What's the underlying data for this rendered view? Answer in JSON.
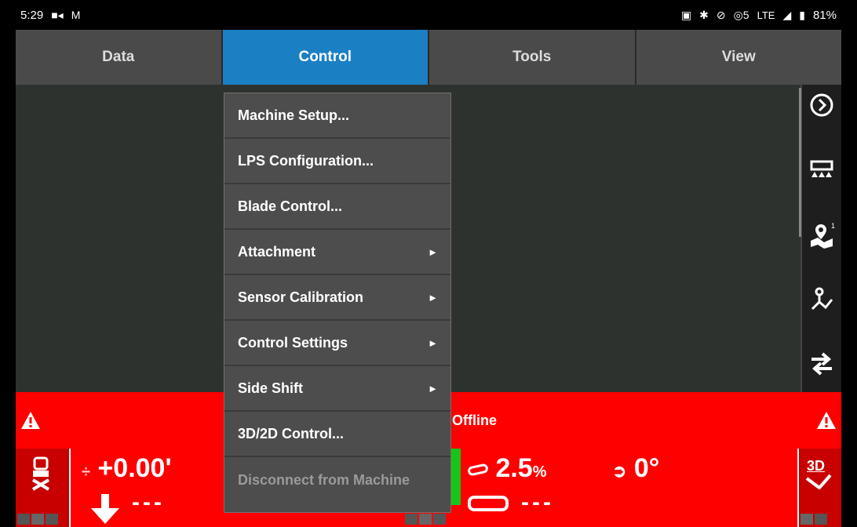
{
  "statusbar": {
    "time": "5:29",
    "left_icons": [
      "video-icon",
      "gmail-icon"
    ],
    "right_text": "LTE",
    "battery": "81%",
    "sim_label": "5"
  },
  "tabs": [
    {
      "label": "Data",
      "active": false
    },
    {
      "label": "Control",
      "active": true
    },
    {
      "label": "Tools",
      "active": false
    },
    {
      "label": "View",
      "active": false
    }
  ],
  "menu": {
    "items": [
      {
        "label": "Machine Setup...",
        "submenu": false,
        "disabled": false
      },
      {
        "label": "LPS Configuration...",
        "submenu": false,
        "disabled": false
      },
      {
        "label": "Blade Control...",
        "submenu": false,
        "disabled": false
      },
      {
        "label": "Attachment",
        "submenu": true,
        "disabled": false
      },
      {
        "label": "Sensor Calibration",
        "submenu": true,
        "disabled": false
      },
      {
        "label": "Control Settings",
        "submenu": true,
        "disabled": false
      },
      {
        "label": "Side Shift",
        "submenu": true,
        "disabled": false
      },
      {
        "label": "3D/2D Control...",
        "submenu": false,
        "disabled": false
      },
      {
        "label": "Disconnect from Machine",
        "submenu": false,
        "disabled": true
      }
    ],
    "submenu_arrow": "►"
  },
  "alert": {
    "text": "Offline"
  },
  "bottom": {
    "elevation": "+0.00'",
    "elevation_dashes": "---",
    "slope_value": "2.5",
    "slope_unit": "%",
    "rotation_value": "0°",
    "slope_dashes": "---",
    "mode_label": "3D"
  },
  "colors": {
    "active_tab": "#1b7fc4",
    "alert_bg": "#ff0000",
    "menu_bg": "#4d4d4d",
    "ok_green": "#18c41a"
  }
}
